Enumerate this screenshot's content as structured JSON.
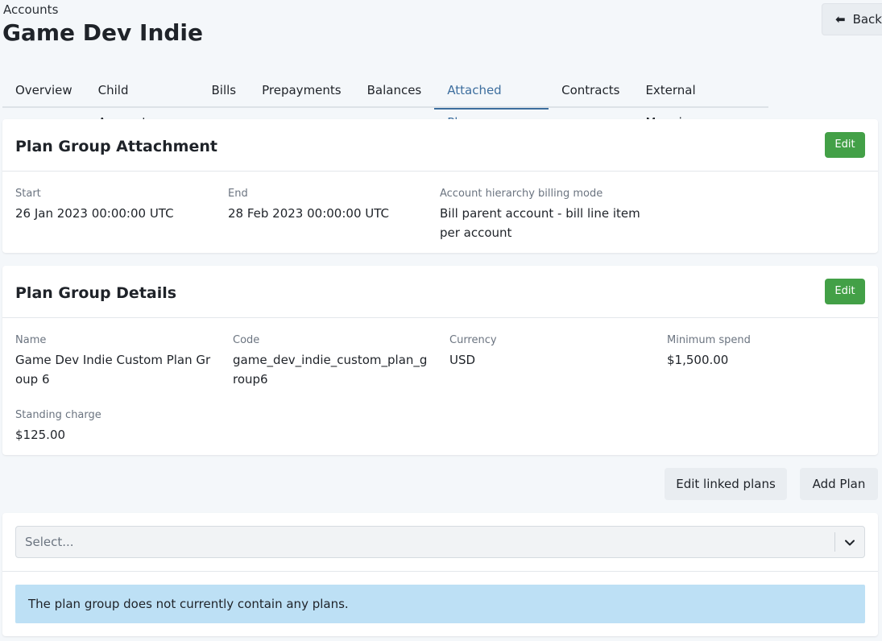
{
  "breadcrumb": "Accounts",
  "title": "Game Dev Indie",
  "back_button": {
    "icon": "arrow-left-icon",
    "label": "Back"
  },
  "tabs": [
    {
      "label": "Overview",
      "active": false
    },
    {
      "label": "Child Accounts",
      "active": false
    },
    {
      "label": "Bills",
      "active": false
    },
    {
      "label": "Prepayments",
      "active": false
    },
    {
      "label": "Balances",
      "active": false
    },
    {
      "label": "Attached Plans",
      "active": true
    },
    {
      "label": "Contracts",
      "active": false
    },
    {
      "label": "External Mappings",
      "active": false
    }
  ],
  "attachment": {
    "title": "Plan Group Attachment",
    "edit_label": "Edit",
    "start_label": "Start",
    "start_value": "26 Jan 2023 00:00:00 UTC",
    "end_label": "End",
    "end_value": "28 Feb 2023 00:00:00 UTC",
    "mode_label": "Account hierarchy billing mode",
    "mode_value": "Bill parent account - bill line item per account"
  },
  "details": {
    "title": "Plan Group Details",
    "edit_label": "Edit",
    "name_label": "Name",
    "name_value": "Game Dev Indie Custom Plan Group 6",
    "code_label": "Code",
    "code_value": "game_dev_indie_custom_plan_group6",
    "currency_label": "Currency",
    "currency_value": "USD",
    "min_spend_label": "Minimum spend",
    "min_spend_value": "$1,500.00",
    "standing_label": "Standing charge",
    "standing_value": "$125.00"
  },
  "actions": {
    "edit_linked": "Edit linked plans",
    "add_plan": "Add Plan"
  },
  "plans": {
    "select_placeholder": "Select...",
    "empty_message": "The plan group does not currently contain any plans."
  },
  "colors": {
    "accent": "#3d6e9e",
    "edit_button": "#43a047",
    "info_alert": "#bde0f5"
  }
}
